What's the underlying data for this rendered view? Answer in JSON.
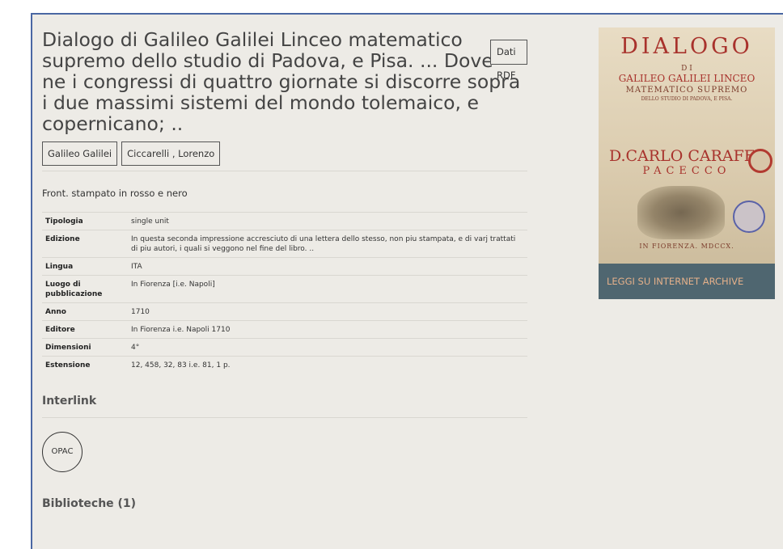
{
  "record": {
    "title": "Dialogo di Galileo Galilei Linceo matematico supremo dello studio di Padova, e Pisa. ... Dove ne i congressi di quattro giornate si discorre sopra i due massimi sistemi del mondo tolemaico, e copernicano; ..",
    "rdf_button": "Dati RDF",
    "authors": [
      "Galileo Galilei",
      "Ciccarelli , Lorenzo"
    ],
    "note": "Front. stampato in rosso e nero"
  },
  "metadata": [
    {
      "label": "Tipologia",
      "value": "single unit"
    },
    {
      "label": "Edizione",
      "value": "In questa seconda impressione accresciuto di una lettera dello stesso, non piu stampata, e di varj trattati di piu autori, i quali si veggono nel fine del libro. .."
    },
    {
      "label": "Lingua",
      "value": "ITA"
    },
    {
      "label": "Luogo di pubblicazione",
      "value": "In Fiorenza [i.e. Napoli]"
    },
    {
      "label": "Anno",
      "value": "1710"
    },
    {
      "label": "Editore",
      "value": "In Fiorenza i.e. Napoli 1710"
    },
    {
      "label": "Dimensioni",
      "value": "4°"
    },
    {
      "label": "Estensione",
      "value": "12, 458, 32, 83 i.e. 81, 1 p."
    }
  ],
  "interlink": {
    "heading": "Interlink",
    "opac_label": "OPAC"
  },
  "libraries": {
    "heading": "Biblioteche (1)"
  },
  "sidebar": {
    "cover": {
      "title": "DIALOGO",
      "lines": [
        "D I",
        "GALILEO GALILEI LINCEO",
        "MATEMATICO SUPREMO",
        "DELLO STUDIO DI PADOVA, E PISA."
      ],
      "dedicatee": "D.CARLO CARAFFA",
      "dedicatee2": "PACECCO",
      "imprint": "IN FIORENZA. MDCCX."
    },
    "archive_button": "LEGGI SU INTERNET ARCHIVE"
  },
  "colors": {
    "page_bg": "#edebe6",
    "frame_border": "#4a67a3",
    "archive_button_bg": "#4f6670",
    "archive_button_text": "#e4b08a",
    "cover_red": "#a8322c"
  }
}
